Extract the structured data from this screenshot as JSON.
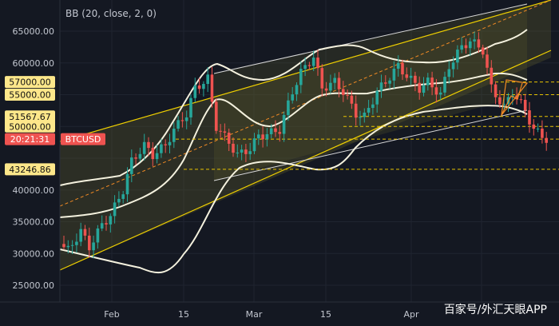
{
  "study_title": "BB (20, close, 2, 0)",
  "watermark": "百家号/外汇天眼APP",
  "colors": {
    "background": "#141822",
    "grid": "#1f2430",
    "bull": "#26a69a",
    "bear": "#ef5350",
    "band": "#f4f1de",
    "channel": "#f0d000",
    "price_line": "#ef5350",
    "level_line": "#e7c300",
    "fill_band": "#2d3a4a",
    "fill_channel": "#5a5a2a",
    "tag_level_bg": "#fde78a",
    "tag_price_bg": "#ef5350"
  },
  "axis": {
    "y_ticks": [
      "65000.00",
      "60000.00",
      "40000.00",
      "35000.00",
      "30000.00",
      "25000.00"
    ],
    "x_ticks": [
      "Feb",
      "15",
      "Mar",
      "15",
      "Apr"
    ]
  },
  "levels": [
    {
      "label": "57000.00",
      "value": 57000
    },
    {
      "label": "55000.00",
      "value": 55000
    },
    {
      "label": "51567.67",
      "value": 51567.67
    },
    {
      "label": "50000.00",
      "value": 50000
    },
    {
      "label": "43246.86",
      "value": 43246.86
    }
  ],
  "price_tag": {
    "time": "20:21:31",
    "symbol": "BTCUSD",
    "value": 48000
  },
  "chart_data": {
    "type": "candlestick",
    "title": "",
    "xlabel": "",
    "ylabel": "",
    "ylim": [
      23000,
      70000
    ],
    "indicator": "BB (20, close, 2, 0)",
    "price_range": {
      "low": 29500,
      "high": 64800,
      "last": 47500
    },
    "x_ticks": [
      "Feb",
      "15",
      "Mar",
      "15",
      "Apr"
    ],
    "annotations": [
      "57000.00",
      "55000.00",
      "51567.67",
      "50000.00",
      "43246.86",
      "20:21:31",
      "BTCUSD"
    ]
  }
}
